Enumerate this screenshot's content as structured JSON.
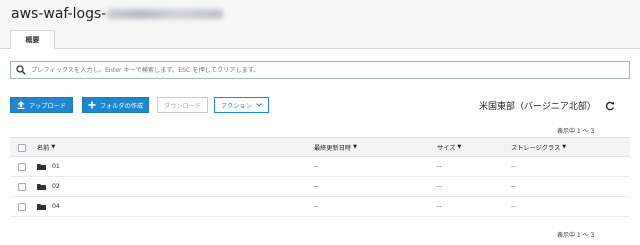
{
  "page": {
    "title": "aws-waf-logs-"
  },
  "tabs": [
    {
      "label": "概要"
    }
  ],
  "search": {
    "placeholder": "プレフィックスを入力し、Enter キーで検索します。ESC を押してクリアします。"
  },
  "toolbar": {
    "upload": "アップロード",
    "create_folder": "フォルダの作成",
    "download": "ダウンロード",
    "actions": "アクション"
  },
  "region": "米国東部（バージニア北部）",
  "pagination": {
    "top": "表示中 1 〜 3",
    "bottom": "表示中 1 〜 3"
  },
  "table": {
    "columns": [
      "名前",
      "最終更新日時",
      "サイズ",
      "ストレージクラス"
    ],
    "rows": [
      {
        "name": "01",
        "modified": "--",
        "size": "--",
        "storage": "--"
      },
      {
        "name": "02",
        "modified": "--",
        "size": "--",
        "storage": "--"
      },
      {
        "name": "04",
        "modified": "--",
        "size": "--",
        "storage": "--"
      }
    ]
  },
  "colors": {
    "primary": "#1f86cf",
    "header_bg": "#f2f3f3"
  }
}
